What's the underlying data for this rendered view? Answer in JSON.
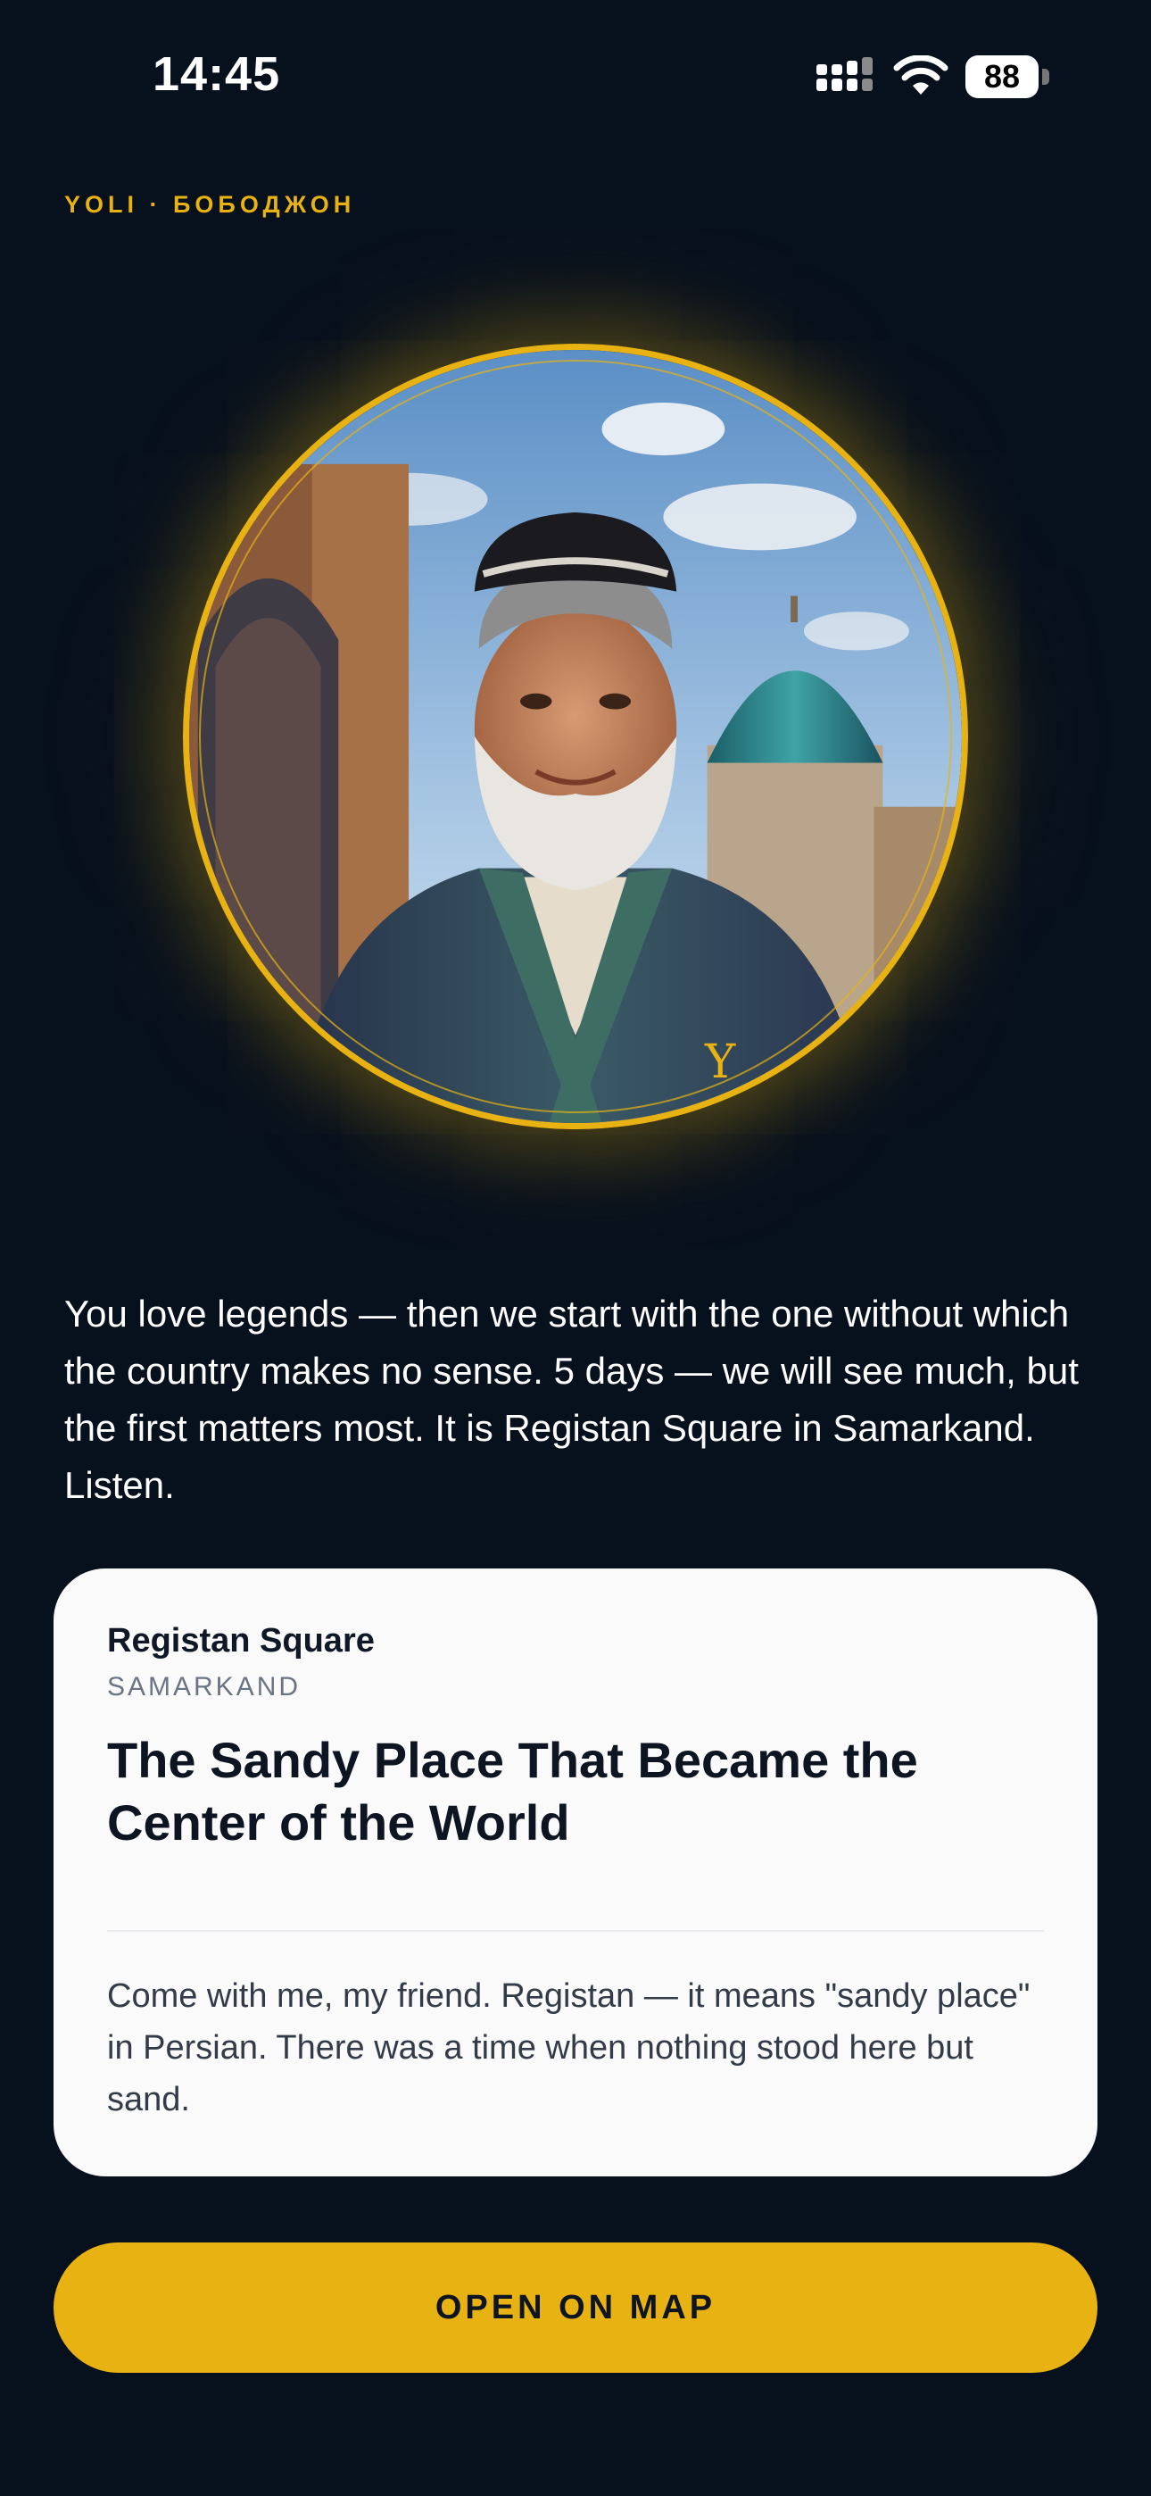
{
  "status_bar": {
    "time": "14:45",
    "battery_level": "88",
    "icons": [
      "cellular-signal-icon",
      "wifi-icon",
      "battery-icon"
    ]
  },
  "brand": {
    "label": "YOLI · БОБОДЖОН"
  },
  "guide": {
    "portrait": "guide-portrait-image",
    "monogram": "Y"
  },
  "intro": {
    "text": "You love legends — then we start with the one without which the country makes no sense. 5 days — we will see much, but the first matters most. It is Registan Square in Samarkand. Listen."
  },
  "card": {
    "place_name": "Registan Square",
    "city": "SAMARKAND",
    "headline": "The Sandy Place That Became the Center of the World",
    "excerpt": "Come with me, my friend. Registan — it means \"sandy place\" in Persian. There was a time when nothing stood here but sand."
  },
  "actions": {
    "open_map_label": "OPEN ON MAP"
  },
  "colors": {
    "background": "#07101d",
    "accent": "#e8b213",
    "card": "#fafafa"
  }
}
